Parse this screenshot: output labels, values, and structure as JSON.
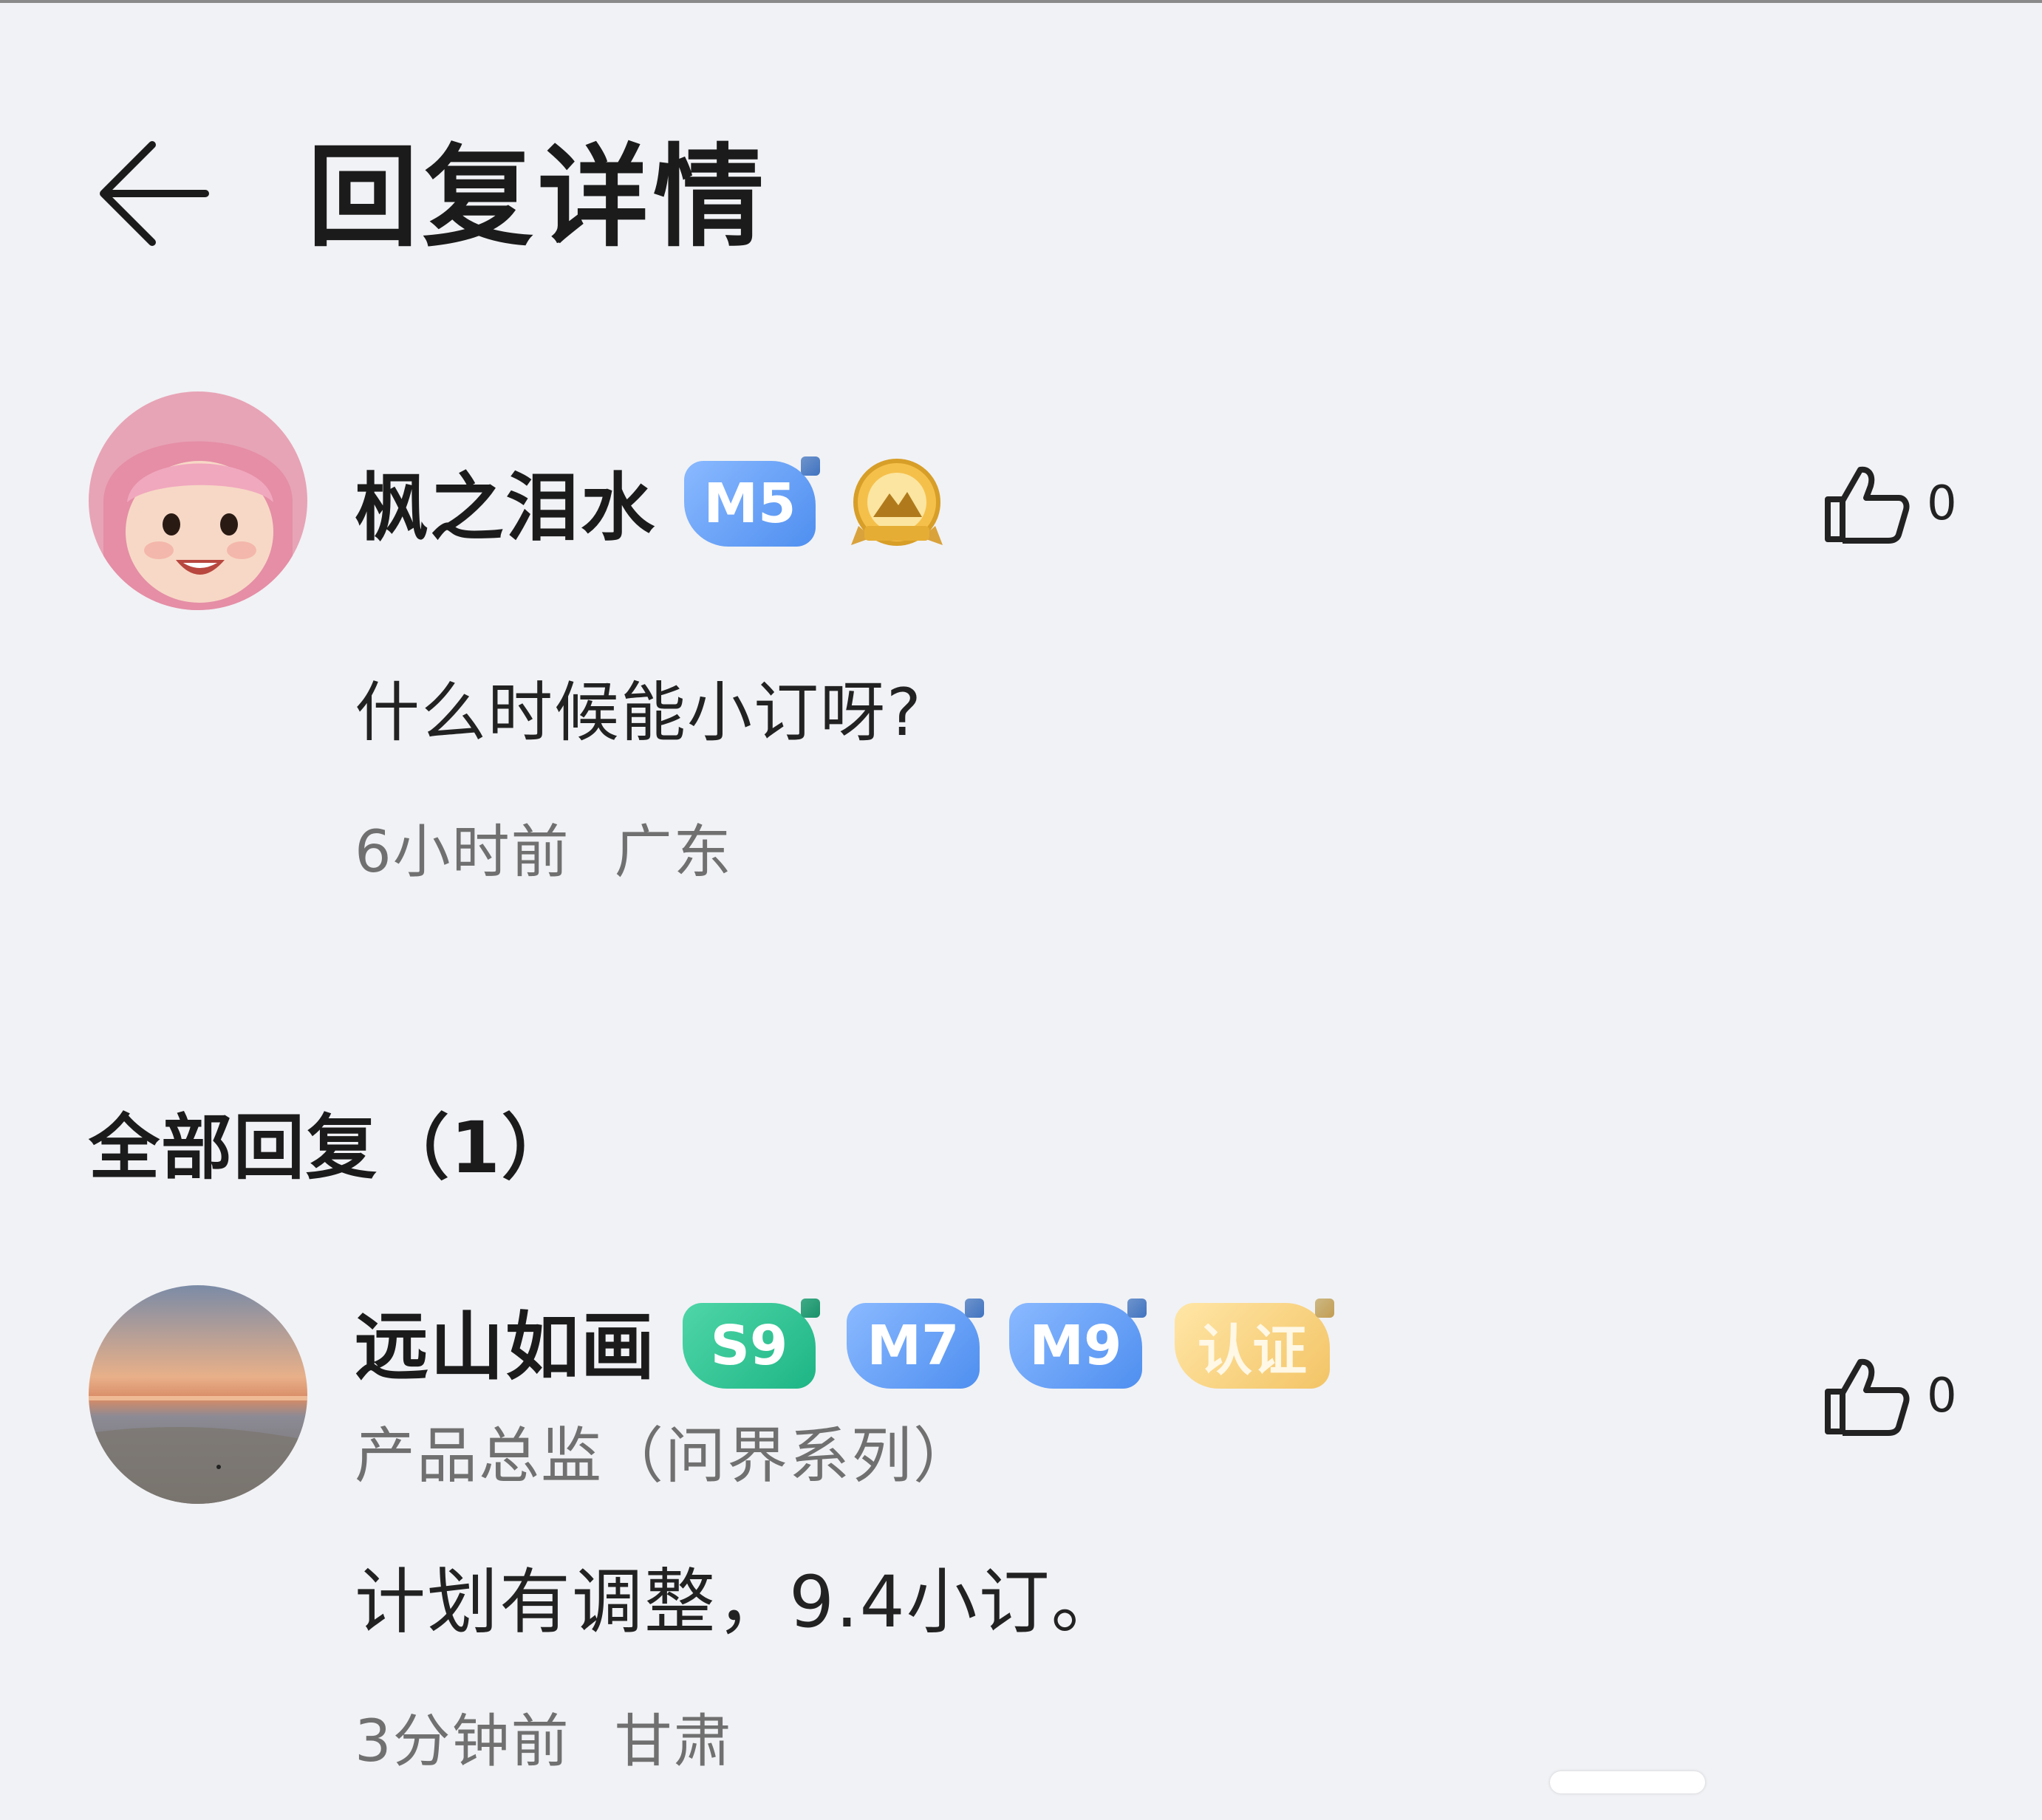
{
  "header": {
    "title": "回复详情",
    "back_icon": "arrow-left-icon"
  },
  "original_post": {
    "username": "枫之泪水",
    "badges": [
      {
        "label": "M5",
        "color": "#5b9af2"
      }
    ],
    "medal_icon": "mountain-medal-icon",
    "like_count": "0",
    "content": "什么时候能小订呀?",
    "time": "6小时前",
    "location": "广东"
  },
  "replies_section": {
    "title": "全部回复（1）"
  },
  "replies": [
    {
      "username": "远山如画",
      "badges": [
        {
          "label": "S9",
          "color": "#25bf8c"
        },
        {
          "label": "M7",
          "color": "#5b9af2"
        },
        {
          "label": "M9",
          "color": "#5b9af2"
        },
        {
          "label": "认证",
          "color": "#f4c96e"
        }
      ],
      "user_title": "产品总监（问界系列）",
      "like_count": "0",
      "content": "计划有调整，9.4小订。",
      "time": "3分钟前",
      "location": "甘肃"
    }
  ]
}
